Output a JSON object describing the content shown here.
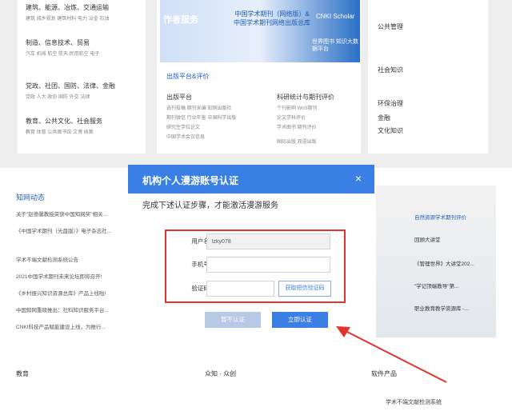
{
  "background": {
    "col1": {
      "rows": [
        "建筑、能源、冶炼、交通运输",
        "制造、信息技术、贸易",
        "党政、社团、国防、法律、金融",
        "教育、公共文化、社会服务"
      ],
      "sub_rows": [
        "建筑  城乡规划  建筑材料  电力  冶金  石油",
        "汽车  机械  航空  航天  民用航空  电子",
        "党政  人大  政协  国防  外交  法律",
        "教育  体育  公共图书馆  文博  档案"
      ]
    },
    "col2": {
      "banner": {
        "left": "作者服务",
        "middle": "中国学术期刊（网络版）& 中国学术期刊网络出版总库",
        "right": "CNKI Scholar",
        "right2": "世界图书 知识大数据平台"
      },
      "platform_title": "出版平台&评价",
      "left_head": "出版平台",
      "left_items": [
        "选刊投稿  期刊采编  知网出版社",
        "期刊微信  行业年鉴  中国科学出版",
        "研究生学位论文",
        "中国学术会议信息"
      ],
      "right_head": "科研统计与期刊评价",
      "right_items": [
        "个刊影响  WoS期刊",
        "论文学科评价",
        "学术图书  期刊评价",
        "国际出版  双语出版"
      ]
    },
    "col3": {
      "items": [
        "公共管理",
        "社会知识",
        "环保治理",
        "金融",
        "文化知识"
      ]
    },
    "news": {
      "title": "知网动态",
      "items": [
        "关于\"赵德馨教授荣获中国知网奖\"相关...",
        "《中国学术期刊（光盘版）》电子杂志社...",
        "学术不端文献检测系统公告",
        "2021中国学术期刊未来论坛即将召开!",
        "《乡村振兴知识资源总库》产品上线啦!",
        "中国知网重磅推出：社科知识服务平台...",
        "CNKI科技产品赋能建设上线，为推行..."
      ]
    },
    "right_panel": {
      "items": [
        "自然资源学术期刊评价",
        "回顾大讲堂",
        "《管理世界》大讲堂202...",
        "\"学记顶端教导\"第...",
        "职业教育教学资源库 -..."
      ]
    },
    "footer": {
      "education": "教育",
      "crowd": "众知 · 众创",
      "software": "软件产品",
      "software_item": "学术不端文献检测系统"
    }
  },
  "modal": {
    "title": "机构个人漫游账号认证",
    "close_glyph": "×",
    "subtitle": "完成下述认证步骤，才能激活漫游服务",
    "fields": {
      "username_label": "用户名:",
      "username_value": "lzky078",
      "phone_label": "手机号:",
      "phone_value": "",
      "code_label": "验证码:",
      "code_value": "",
      "get_code_label": "获取短信验证码"
    },
    "buttons": {
      "later": "暂不认证",
      "now": "立即认证"
    },
    "highlight_color": "#e2332f",
    "accent_color": "#3a7fe4"
  }
}
